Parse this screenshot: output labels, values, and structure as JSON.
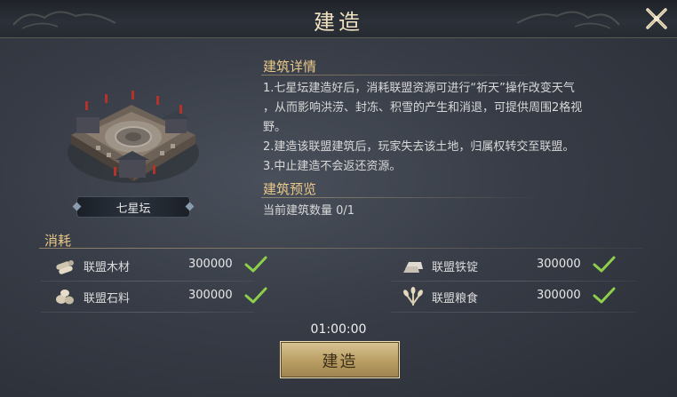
{
  "dialog": {
    "title": "建造"
  },
  "building": {
    "name": "七星坛"
  },
  "details": {
    "heading": "建筑详情",
    "lines": [
      "1.七星坛建造好后，消耗联盟资源可进行“祈天”操作改变天气",
      "，从而影响洪涝、封冻、积雪的产生和消退，可提供周围2格视",
      "野。",
      "2.建造该联盟建筑后，玩家失去该土地，归属权转交至联盟。",
      "3.中止建造不会返还资源。"
    ]
  },
  "preview": {
    "heading": "建筑预览",
    "count_text": "当前建筑数量 0/1"
  },
  "cost": {
    "heading": "消耗",
    "items": [
      {
        "name": "联盟木材",
        "amount": "300000",
        "icon": "wood-icon",
        "satisfied": true
      },
      {
        "name": "联盟铁锭",
        "amount": "300000",
        "icon": "iron-ingot-icon",
        "satisfied": true
      },
      {
        "name": "联盟石料",
        "amount": "300000",
        "icon": "stone-icon",
        "satisfied": true
      },
      {
        "name": "联盟粮食",
        "amount": "300000",
        "icon": "grain-icon",
        "satisfied": true
      }
    ]
  },
  "timer": "01:00:00",
  "build_button": "建造",
  "colors": {
    "accent_gold": "#e9c889",
    "check_green": "#8fd04b",
    "button_gold": "#c9b07a"
  }
}
